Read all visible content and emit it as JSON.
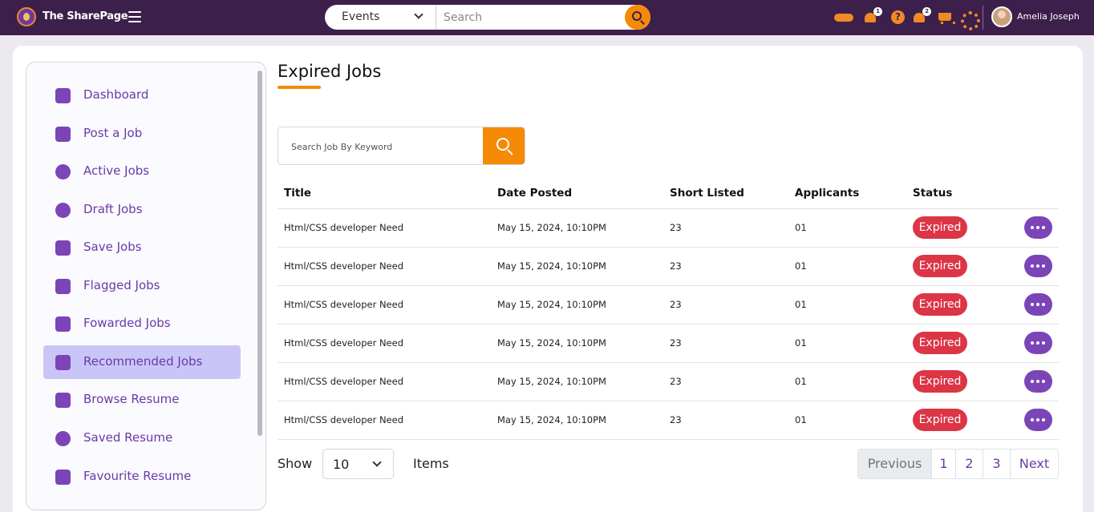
{
  "app": {
    "brand": "The SharePage"
  },
  "topbar": {
    "search_category": "Events",
    "search_placeholder": "Search",
    "notification_badge": "1",
    "alert_badge": "2",
    "user_name": "Amelia Joseph"
  },
  "sidebar": {
    "items": [
      {
        "label": "Dashboard",
        "icon": "chart-bar-icon"
      },
      {
        "label": "Post a Job",
        "icon": "scroll-icon"
      },
      {
        "label": "Active Jobs",
        "icon": "target-cursor-icon"
      },
      {
        "label": "Draft Jobs",
        "icon": "circle-dots-icon"
      },
      {
        "label": "Save Jobs",
        "icon": "bookmarks-icon"
      },
      {
        "label": "Flagged Jobs",
        "icon": "flag-icon"
      },
      {
        "label": "Fowarded Jobs",
        "icon": "forward-arrow-icon"
      },
      {
        "label": "Recommended Jobs",
        "icon": "recommend-icon"
      },
      {
        "label": "Browse Resume",
        "icon": "document-icon"
      },
      {
        "label": "Saved Resume",
        "icon": "heart-icon"
      },
      {
        "label": "Favourite Resume",
        "icon": "favourite-document-icon"
      }
    ],
    "active_index": 7
  },
  "main": {
    "title": "Expired Jobs",
    "keyword_placeholder": "Search Job By Keyword",
    "table": {
      "columns": [
        "Title",
        "Date Posted",
        "Short Listed",
        "Applicants",
        "Status"
      ],
      "rows": [
        {
          "title": "Html/CSS developer Need",
          "date": "May 15, 2024, 10:10PM",
          "short_listed": "23",
          "applicants": "01",
          "status": "Expired"
        },
        {
          "title": "Html/CSS developer Need",
          "date": "May 15, 2024, 10:10PM",
          "short_listed": "23",
          "applicants": "01",
          "status": "Expired"
        },
        {
          "title": "Html/CSS developer Need",
          "date": "May 15, 2024, 10:10PM",
          "short_listed": "23",
          "applicants": "01",
          "status": "Expired"
        },
        {
          "title": "Html/CSS developer Need",
          "date": "May 15, 2024, 10:10PM",
          "short_listed": "23",
          "applicants": "01",
          "status": "Expired"
        },
        {
          "title": "Html/CSS developer Need",
          "date": "May 15, 2024, 10:10PM",
          "short_listed": "23",
          "applicants": "01",
          "status": "Expired"
        },
        {
          "title": "Html/CSS developer Need",
          "date": "May 15, 2024, 10:10PM",
          "short_listed": "23",
          "applicants": "01",
          "status": "Expired"
        }
      ]
    },
    "footer": {
      "show_label": "Show",
      "page_size": "10",
      "items_label": "Items",
      "pagination": {
        "previous": "Previous",
        "pages": [
          "1",
          "2",
          "3"
        ],
        "next": "Next"
      }
    }
  },
  "colors": {
    "topbar": "#3d1f4b",
    "accent_orange": "#f58a07",
    "purple": "#7b45b8",
    "expired_red": "#dc3545",
    "active_sidebar": "#c9c6f7"
  }
}
